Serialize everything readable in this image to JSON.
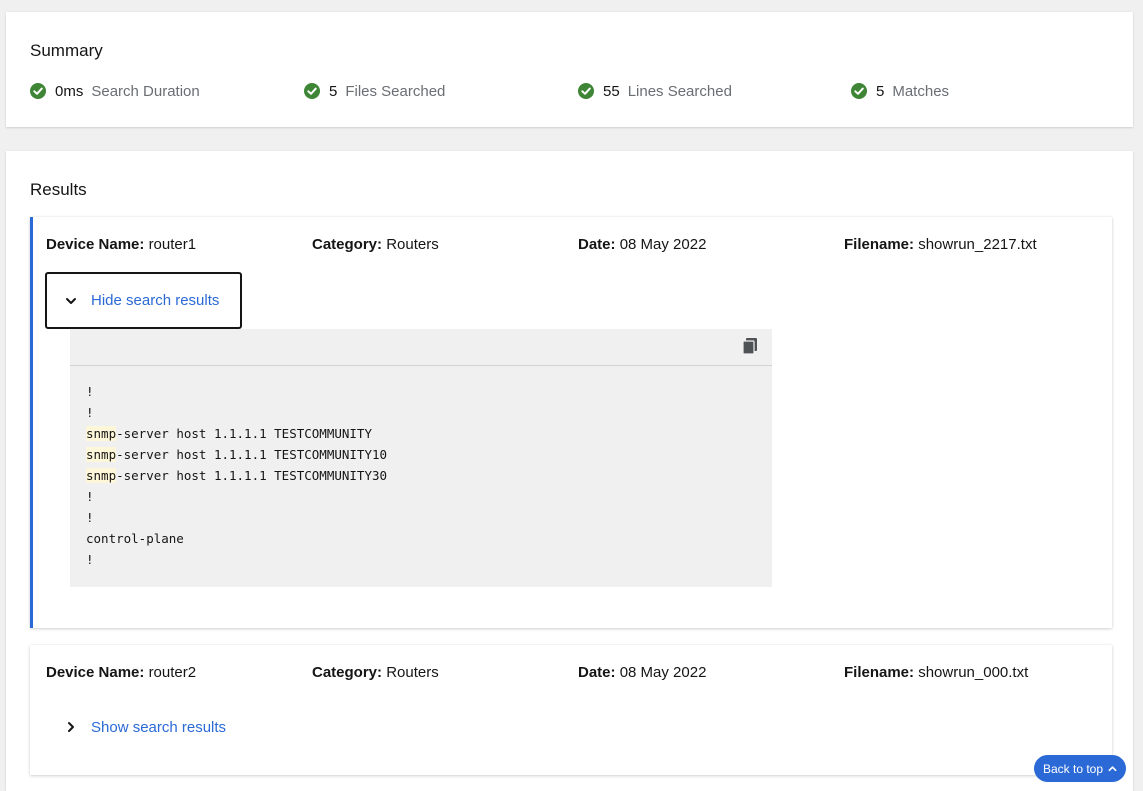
{
  "summary": {
    "title": "Summary",
    "stats": [
      {
        "value": "0ms",
        "label": "Search Duration"
      },
      {
        "value": "5",
        "label": "Files Searched"
      },
      {
        "value": "55",
        "label": "Lines Searched"
      },
      {
        "value": "5",
        "label": "Matches"
      }
    ]
  },
  "results": {
    "title": "Results",
    "labels": {
      "device": "Device Name:",
      "category": "Category:",
      "date": "Date:",
      "filename": "Filename:"
    },
    "items": [
      {
        "device": "router1",
        "category": "Routers",
        "date": "08 May 2022",
        "filename": "showrun_2217.txt",
        "toggle_label": "Hide search results",
        "expanded": true,
        "code_lines": [
          {
            "match": "",
            "rest": "!"
          },
          {
            "match": "",
            "rest": "!"
          },
          {
            "match": "snmp",
            "rest": "-server host 1.1.1.1 TESTCOMMUNITY"
          },
          {
            "match": "snmp",
            "rest": "-server host 1.1.1.1 TESTCOMMUNITY10"
          },
          {
            "match": "snmp",
            "rest": "-server host 1.1.1.1 TESTCOMMUNITY30"
          },
          {
            "match": "",
            "rest": "!"
          },
          {
            "match": "",
            "rest": "!"
          },
          {
            "match": "",
            "rest": "control-plane"
          },
          {
            "match": "",
            "rest": "!"
          }
        ]
      },
      {
        "device": "router2",
        "category": "Routers",
        "date": "08 May 2022",
        "filename": "showrun_000.txt",
        "toggle_label": "Show search results",
        "expanded": false
      }
    ]
  },
  "back_to_top": {
    "label": "Back to top"
  },
  "icons": {
    "stat": "check-circle-icon",
    "copy": "copy-icon",
    "expanded": "chevron-down-icon",
    "collapsed": "chevron-right-icon",
    "up": "chevron-up-icon"
  },
  "colors": {
    "success": "#3e8635",
    "link": "#2b6ad6",
    "highlight": "#fdf6d8",
    "accent_border": "#2b6ad6"
  }
}
